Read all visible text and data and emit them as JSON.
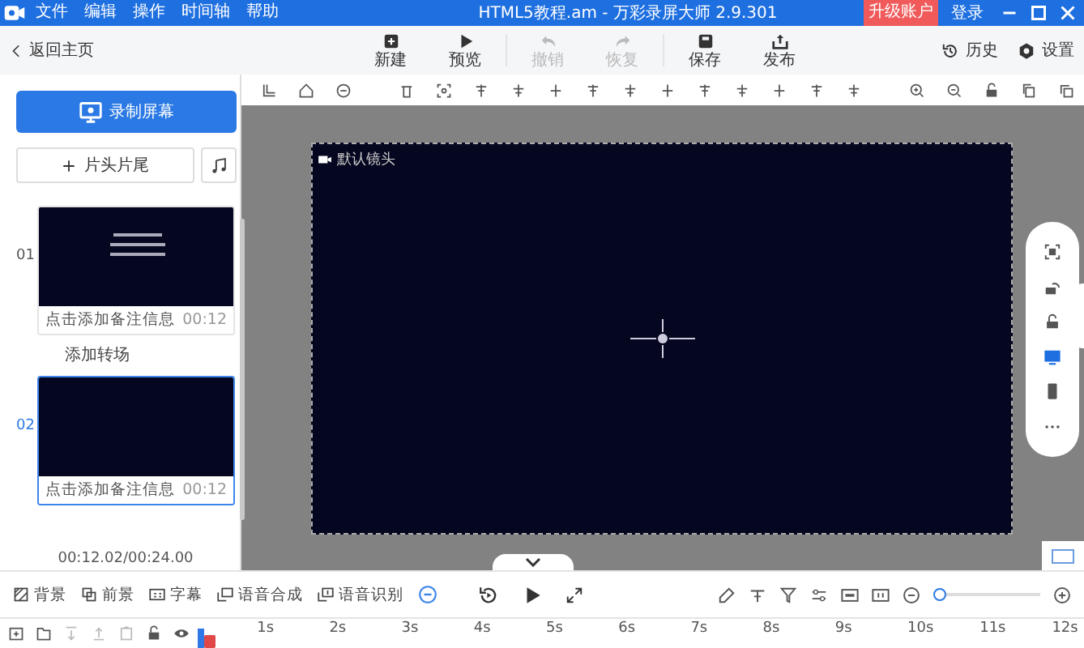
{
  "title_bar": {
    "menu": [
      "文件",
      "编辑",
      "操作",
      "时间轴",
      "帮助"
    ],
    "title": "HTML5教程.am - 万彩录屏大师 2.9.301",
    "upgrade": "升级账户",
    "login": "登录"
  },
  "toolbar": {
    "back": "返回主页",
    "actions": [
      {
        "label": "新建",
        "kind": "new",
        "disabled": false
      },
      {
        "label": "预览",
        "kind": "play",
        "disabled": false
      },
      {
        "label": "撤销",
        "kind": "undo",
        "disabled": true
      },
      {
        "label": "恢复",
        "kind": "redo",
        "disabled": true
      },
      {
        "label": "保存",
        "kind": "save",
        "disabled": false
      },
      {
        "label": "发布",
        "kind": "publish",
        "disabled": false
      }
    ],
    "right": [
      {
        "label": "历史",
        "kind": "history"
      },
      {
        "label": "设置",
        "kind": "settings"
      }
    ]
  },
  "left_panel": {
    "record": "录制屏幕",
    "intro": "片头片尾",
    "scenes": [
      {
        "number": "01",
        "note": "点击添加备注信息",
        "duration": "00:12",
        "selected": false,
        "kind": "text"
      },
      {
        "number": "02",
        "note": "点击添加备注信息",
        "duration": "00:12",
        "selected": true,
        "kind": "blank"
      }
    ],
    "transition": "添加转场",
    "time": "00:12.02/00:24.00"
  },
  "canvas": {
    "camera_label": "默认镜头"
  },
  "side_tools": [
    {
      "kind": "fit",
      "selected": false
    },
    {
      "kind": "rotate",
      "selected": false
    },
    {
      "kind": "lock",
      "selected": false
    },
    {
      "kind": "monitor",
      "selected": true
    },
    {
      "kind": "phone",
      "selected": false
    },
    {
      "kind": "more",
      "selected": false
    }
  ],
  "bottom_toolbar": {
    "items": [
      {
        "label": "背景",
        "kind": "background"
      },
      {
        "label": "前景",
        "kind": "foreground"
      },
      {
        "label": "字幕",
        "kind": "caption"
      },
      {
        "label": "语音合成",
        "kind": "tts"
      },
      {
        "label": "语音识别",
        "kind": "asr"
      }
    ],
    "zoom": {
      "level": 0.06
    }
  },
  "timeline": {
    "ticks": [
      "1s",
      "2s",
      "3s",
      "4s",
      "5s",
      "6s",
      "7s",
      "8s",
      "9s",
      "10s",
      "11s",
      "12s"
    ]
  }
}
